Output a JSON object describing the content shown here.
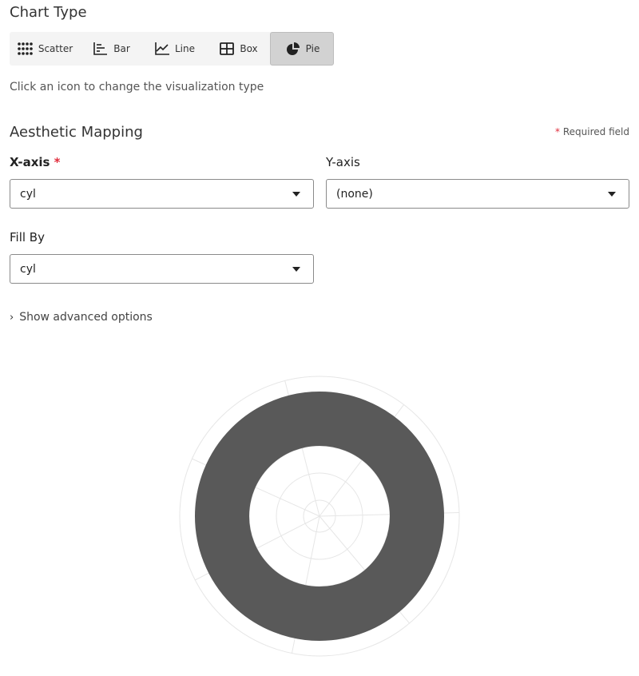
{
  "chart_type": {
    "title": "Chart Type",
    "buttons": [
      {
        "label": "Scatter",
        "icon": "scatter-icon",
        "active": false
      },
      {
        "label": "Bar",
        "icon": "bar-chart-icon",
        "active": false
      },
      {
        "label": "Line",
        "icon": "line-chart-icon",
        "active": false
      },
      {
        "label": "Box",
        "icon": "box-plot-icon",
        "active": false
      },
      {
        "label": "Pie",
        "icon": "pie-chart-icon",
        "active": true
      }
    ],
    "hint": "Click an icon to change the visualization type"
  },
  "aesthetic": {
    "title": "Aesthetic Mapping",
    "required_star": "*",
    "required_note": "Required field",
    "x_axis": {
      "label": "X-axis",
      "required_star": "*",
      "value": "cyl"
    },
    "y_axis": {
      "label": "Y-axis",
      "value": "(none)"
    },
    "fill_by": {
      "label": "Fill By",
      "value": "cyl"
    },
    "advanced_chevron": "›",
    "advanced_label": "Show advanced options"
  },
  "colors": {
    "accent_required": "#e02d3c",
    "slice": "#595959",
    "grid": "#e6e6e6"
  },
  "chart_data": {
    "type": "pie",
    "variant": "donut",
    "categories": [
      ""
    ],
    "values": [
      1
    ],
    "title": "",
    "grid": true
  }
}
